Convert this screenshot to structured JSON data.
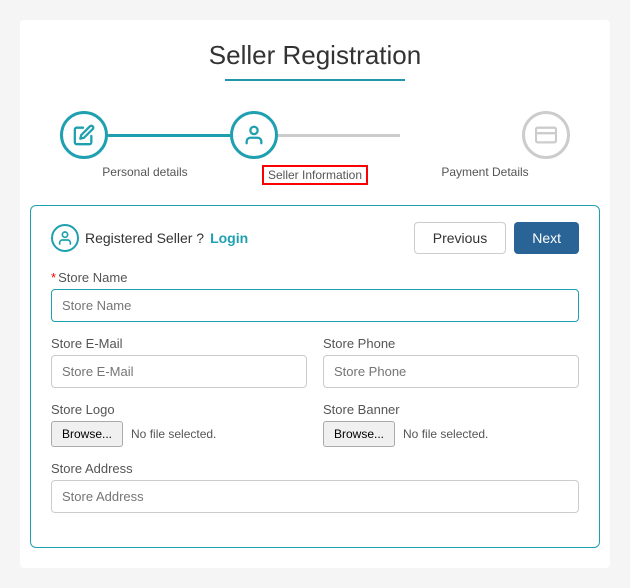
{
  "page": {
    "title": "Seller Registration",
    "title_underline": true
  },
  "steps": [
    {
      "id": "personal-details",
      "label": "Personal details",
      "state": "completed",
      "icon": "edit"
    },
    {
      "id": "seller-information",
      "label": "Seller Information",
      "state": "active",
      "icon": "person"
    },
    {
      "id": "payment-details",
      "label": "Payment Details",
      "state": "inactive",
      "icon": "credit-card"
    }
  ],
  "form": {
    "registered_seller_text": "Registered Seller ?",
    "login_text": "Login",
    "buttons": {
      "previous": "Previous",
      "next": "Next"
    },
    "fields": {
      "store_name": {
        "label": "Store Name",
        "placeholder": "Store Name",
        "required": true
      },
      "store_email": {
        "label": "Store E-Mail",
        "placeholder": "Store E-Mail",
        "required": false
      },
      "store_phone": {
        "label": "Store Phone",
        "placeholder": "Store Phone",
        "required": false
      },
      "store_logo": {
        "label": "Store Logo",
        "browse_label": "Browse...",
        "no_file_text": "No file selected."
      },
      "store_banner": {
        "label": "Store Banner",
        "browse_label": "Browse...",
        "no_file_text": "No file selected."
      },
      "store_address": {
        "label": "Store Address",
        "placeholder": "Store Address",
        "required": false
      }
    }
  }
}
